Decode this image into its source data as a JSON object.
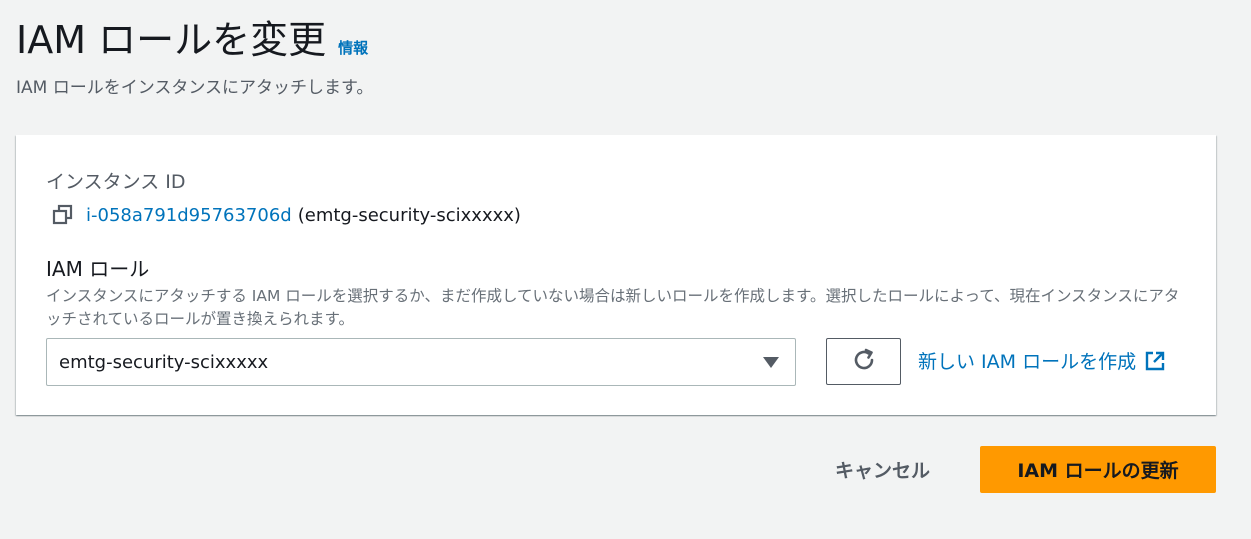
{
  "header": {
    "title": "IAM ロールを変更",
    "info_link": "情報",
    "description": "IAM ロールをインスタンスにアタッチします。"
  },
  "instance": {
    "label": "インスタンス ID",
    "id": "i-058a791d95763706d",
    "name": "(emtg-security-scixxxxx)"
  },
  "iam_role": {
    "label": "IAM ロール",
    "description": "インスタンスにアタッチする IAM ロールを選択するか、まだ作成していない場合は新しいロールを作成します。選択したロールによって、現在インスタンスにアタッチされているロールが置き換えられます。",
    "selected_value": "emtg-security-scixxxxx",
    "create_link": "新しい IAM ロールを作成"
  },
  "footer": {
    "cancel_label": "キャンセル",
    "submit_label": "IAM ロールの更新"
  },
  "icons": {
    "copy": "copy-icon",
    "refresh": "refresh-icon",
    "external": "external-link-icon",
    "caret": "caret-down-icon"
  },
  "colors": {
    "link": "#0073bb",
    "primary": "#ff9900",
    "background": "#f2f3f3"
  }
}
